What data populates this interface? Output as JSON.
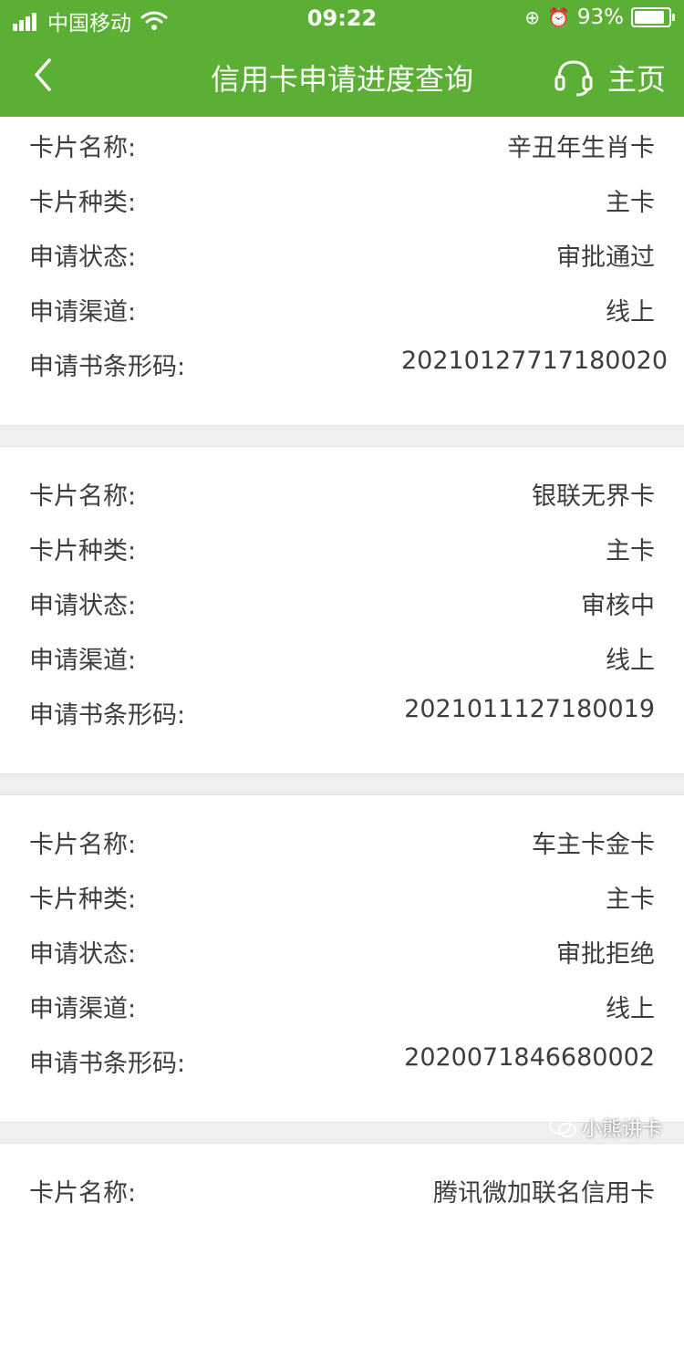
{
  "status_bar": {
    "carrier": "中国移动",
    "time": "09:22",
    "battery_pct": "93%",
    "battery_level": 0.93
  },
  "navbar": {
    "title": "信用卡申请进度查询",
    "home_label": "主页",
    "back_icon": "chevron-left-icon",
    "service_icon": "headset-icon"
  },
  "labels": {
    "card_name": "卡片名称:",
    "card_type": "卡片种类:",
    "status": "申请状态:",
    "channel": "申请渠道:",
    "barcode": "申请书条形码:"
  },
  "cards": [
    {
      "card_name": "辛丑年生肖卡",
      "card_type": "主卡",
      "status": "审批通过",
      "channel": "线上",
      "barcode": "2021012771718002​0"
    },
    {
      "card_name": "银联无界卡",
      "card_type": "主卡",
      "status": "审核中",
      "channel": "线上",
      "barcode": "2021011127180019"
    },
    {
      "card_name": "车主卡金卡",
      "card_type": "主卡",
      "status": "审批拒绝",
      "channel": "线上",
      "barcode": "2020071846680002"
    },
    {
      "card_name": "腾讯微加联名信用卡"
    }
  ],
  "watermark": {
    "text": "小熊讲卡"
  },
  "colors": {
    "header_bg": "#5aaf34",
    "page_bg": "#efeff1",
    "text": "#3d3d3d"
  }
}
